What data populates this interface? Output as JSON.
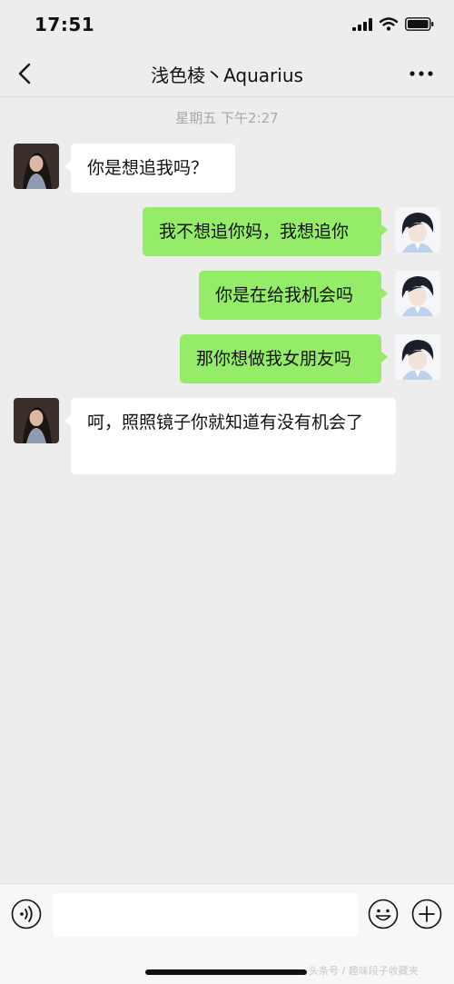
{
  "status_bar": {
    "time": "17:51"
  },
  "nav": {
    "title": "浅色棱丶Aquarius"
  },
  "chat": {
    "timestamp": "星期五 下午2:27",
    "messages": [
      {
        "side": "in",
        "text": "你是想追我吗？"
      },
      {
        "side": "out",
        "text": "我不想追你妈，我想追你"
      },
      {
        "side": "out",
        "text": "你是在给我机会吗"
      },
      {
        "side": "out",
        "text": "那你想做我女朋友吗"
      },
      {
        "side": "in",
        "text": "呵，照照镜子你就知道有没有机会了"
      }
    ]
  },
  "input": {
    "value": "",
    "placeholder": ""
  },
  "watermark": "头条号 / 趣味段子收藏夹",
  "colors": {
    "background": "#ededed",
    "outgoing_bubble": "#95ec69",
    "incoming_bubble": "#ffffff"
  }
}
